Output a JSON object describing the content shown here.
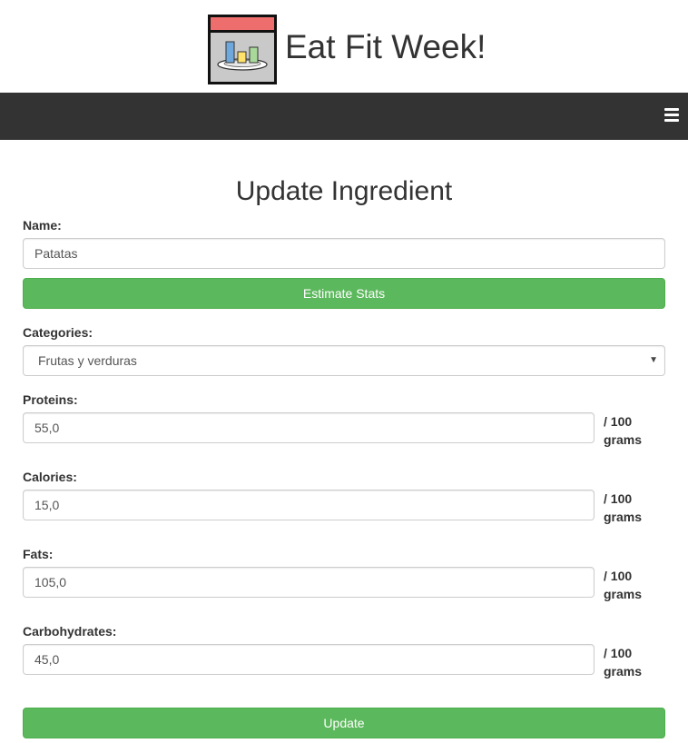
{
  "brand": {
    "title": "Eat Fit Week!"
  },
  "navbar": {
    "menu_icon": "hamburger-icon"
  },
  "page": {
    "title": "Update Ingredient"
  },
  "form": {
    "name": {
      "label": "Name:",
      "value": "Patatas"
    },
    "estimate_button": "Estimate Stats",
    "categories": {
      "label": "Categories:",
      "selected": "Frutas y verduras"
    },
    "proteins": {
      "label": "Proteins:",
      "value": "55,0",
      "unit_line1": "/ 100",
      "unit_line2": "grams"
    },
    "calories": {
      "label": "Calories:",
      "value": "15,0",
      "unit_line1": "/ 100",
      "unit_line2": "grams"
    },
    "fats": {
      "label": "Fats:",
      "value": "105,0",
      "unit_line1": "/ 100",
      "unit_line2": "grams"
    },
    "carbohydrates": {
      "label": "Carbohydrates:",
      "value": "45,0",
      "unit_line1": "/ 100",
      "unit_line2": "grams"
    },
    "update_button": "Update"
  },
  "colors": {
    "navbar": "#333333",
    "button_green": "#5cb85c",
    "logo_red": "#ee6e6e"
  }
}
